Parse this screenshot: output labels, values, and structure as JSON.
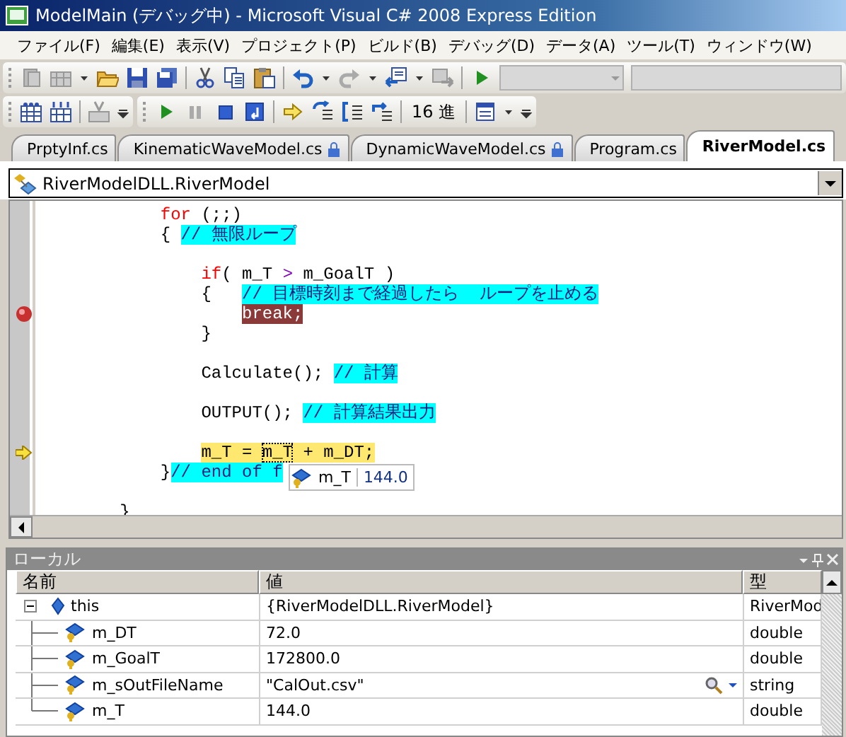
{
  "window": {
    "title": "ModelMain (デバッグ中) - Microsoft Visual C# 2008 Express Edition"
  },
  "menu": [
    "ファイル(F)",
    "編集(E)",
    "表示(V)",
    "プロジェクト(P)",
    "ビルド(B)",
    "デバッグ(D)",
    "データ(A)",
    "ツール(T)",
    "ウィンドウ(W)"
  ],
  "debug_toolbar": {
    "hex_button": "16 進"
  },
  "tabs": [
    {
      "label": "PrptyInf.cs",
      "selected": false,
      "locked": false
    },
    {
      "label": "KinematicWaveModel.cs",
      "selected": false,
      "locked": true
    },
    {
      "label": "DynamicWaveModel.cs",
      "selected": false,
      "locked": true
    },
    {
      "label": "Program.cs",
      "selected": false,
      "locked": false
    },
    {
      "label": "RiverModel.cs",
      "selected": true,
      "locked": false
    }
  ],
  "class_selector": {
    "value": "RiverModelDLL.RiverModel"
  },
  "code_lines": [
    {
      "kind": "block",
      "lines": [
        {
          "kind": "code",
          "breakpoint": false,
          "current": false,
          "segments": [
            {
              "kind": "keyword",
              "text": "for"
            },
            {
              "kind": "plain",
              "text": " (;;)"
            }
          ]
        },
        {
          "kind": "code",
          "breakpoint": false,
          "current": false,
          "segments": [
            {
              "kind": "plain",
              "text": "{ "
            },
            {
              "kind": "comment",
              "text": "// 無限ループ"
            }
          ]
        },
        {
          "kind": "block",
          "lines": [
            {
              "kind": "blank",
              "breakpoint": false,
              "current": false
            },
            {
              "kind": "code",
              "breakpoint": false,
              "current": false,
              "segments": [
                {
                  "kind": "keyword",
                  "text": "if"
                },
                {
                  "kind": "plain",
                  "text": "( m_T "
                },
                {
                  "kind": "operator",
                  "text": ">"
                },
                {
                  "kind": "plain",
                  "text": " m_GoalT )"
                }
              ]
            },
            {
              "kind": "code",
              "breakpoint": false,
              "current": false,
              "segments": [
                {
                  "kind": "plain",
                  "text": "{   "
                },
                {
                  "kind": "comment",
                  "text": "// 目標時刻まで経過したら  ループを止める"
                }
              ]
            },
            {
              "kind": "block",
              "lines": [
                {
                  "kind": "code",
                  "breakpoint": true,
                  "current": false,
                  "segments": [
                    {
                      "kind": "breakhit",
                      "text": "break;"
                    }
                  ]
                }
              ]
            },
            {
              "kind": "code",
              "breakpoint": false,
              "current": false,
              "segments": [
                {
                  "kind": "plain",
                  "text": "}"
                }
              ]
            },
            {
              "kind": "blank",
              "breakpoint": false,
              "current": false
            },
            {
              "kind": "code",
              "breakpoint": false,
              "current": false,
              "segments": [
                {
                  "kind": "plain",
                  "text": "Calculate(); "
                },
                {
                  "kind": "comment",
                  "text": "// 計算"
                }
              ]
            },
            {
              "kind": "blank",
              "breakpoint": false,
              "current": false
            },
            {
              "kind": "code",
              "breakpoint": false,
              "current": false,
              "segments": [
                {
                  "kind": "plain",
                  "text": "OUTPUT(); "
                },
                {
                  "kind": "comment",
                  "text": "// 計算結果出力"
                }
              ]
            },
            {
              "kind": "blank",
              "breakpoint": false,
              "current": false
            },
            {
              "kind": "code",
              "breakpoint": false,
              "current": true,
              "segments": [
                {
                  "kind": "current",
                  "text": "m_T = "
                },
                {
                  "kind": "hovered",
                  "text": "m_T"
                },
                {
                  "kind": "current",
                  "text": " + m_DT;"
                }
              ]
            }
          ]
        },
        {
          "kind": "code",
          "breakpoint": false,
          "current": false,
          "segments": [
            {
              "kind": "plain",
              "text": "}"
            },
            {
              "kind": "comment",
              "text": "// end of f"
            }
          ]
        }
      ]
    },
    {
      "kind": "blank",
      "breakpoint": false,
      "current": false
    },
    {
      "kind": "code",
      "breakpoint": false,
      "current": false,
      "segments": [
        {
          "kind": "plain",
          "text": "}"
        }
      ]
    }
  ],
  "data_tip": {
    "name": "m_T",
    "value": "144.0"
  },
  "locals": {
    "title": "ローカル",
    "columns": [
      "名前",
      "値",
      "型"
    ],
    "rows": [
      {
        "name": "this",
        "value": "{RiverModelDLL.RiverModel}",
        "type": "RiverMod",
        "expanded": true,
        "children": [
          {
            "name": "m_DT",
            "value": "72.0",
            "type": "double",
            "visualizer": false
          },
          {
            "name": "m_GoalT",
            "value": "172800.0",
            "type": "double",
            "visualizer": false
          },
          {
            "name": "m_sOutFileName",
            "value": "\"CalOut.csv\"",
            "type": "string",
            "visualizer": true
          },
          {
            "name": "m_T",
            "value": "144.0",
            "type": "double",
            "visualizer": false
          }
        ]
      }
    ]
  }
}
